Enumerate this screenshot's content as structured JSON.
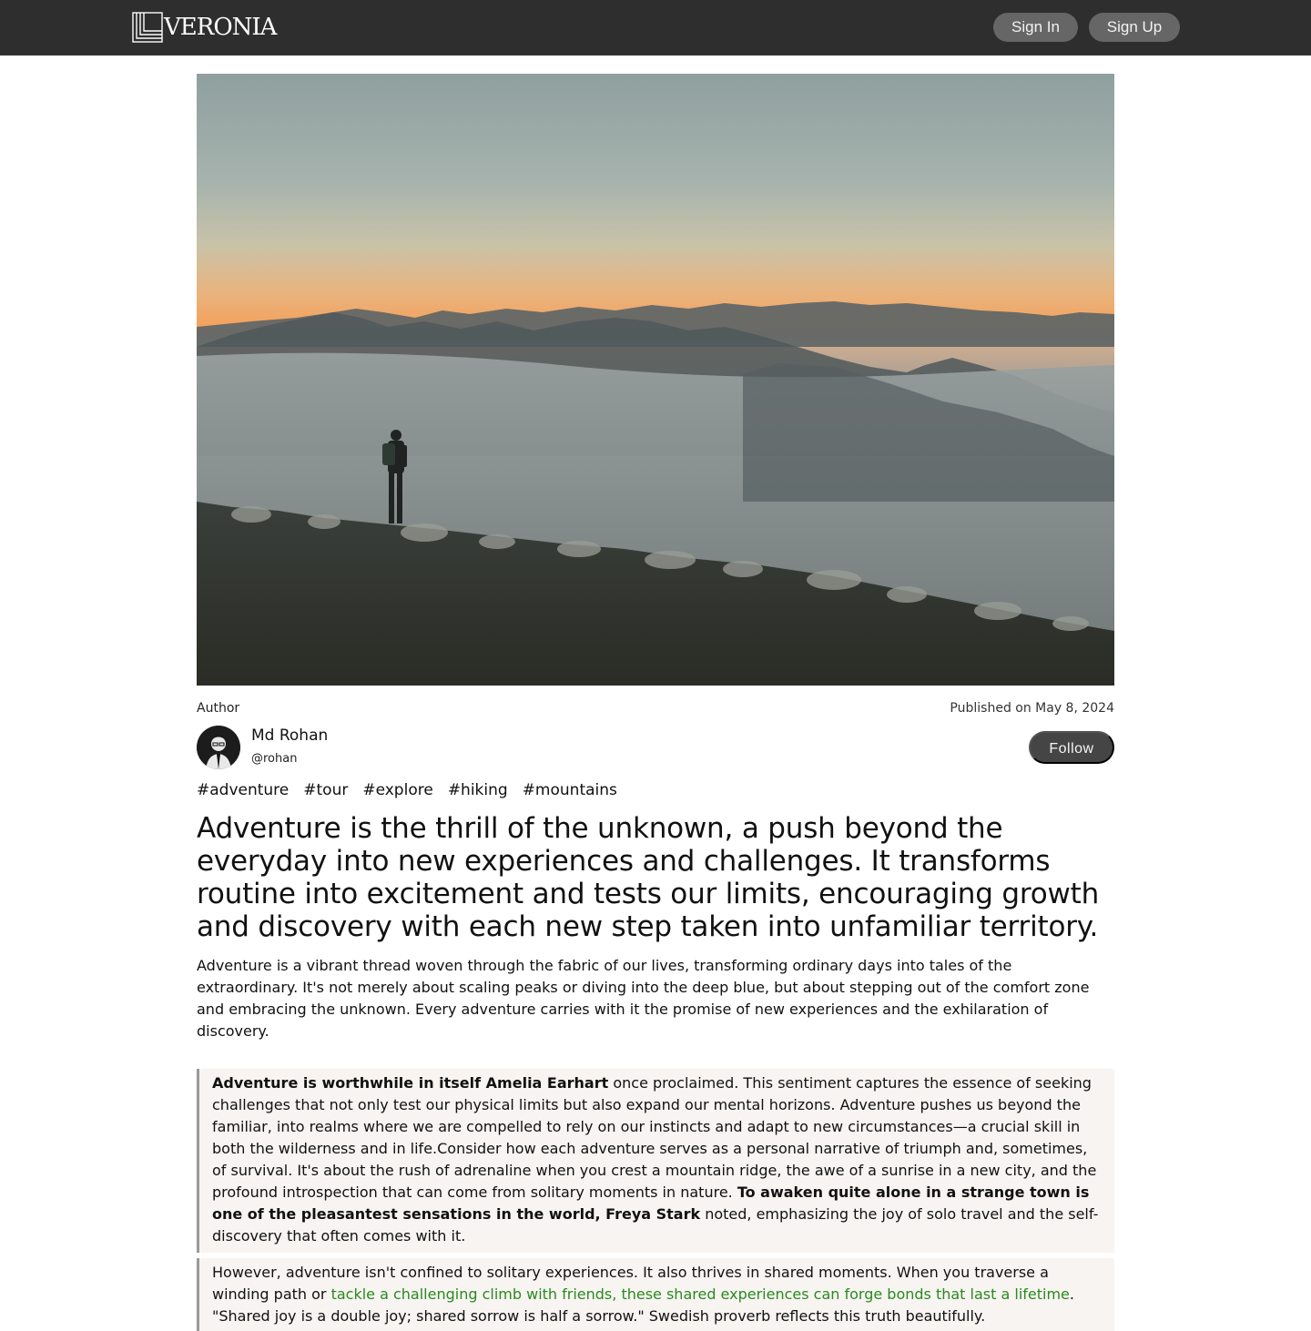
{
  "header": {
    "brand": "VERONIA",
    "sign_in": "Sign In",
    "sign_up": "Sign Up"
  },
  "hero": {
    "icon": "hiker-mountain-photo"
  },
  "author": {
    "label": "Author",
    "name": "Md Rohan",
    "handle": "@rohan",
    "published": "Published on May 8, 2024",
    "follow": "Follow"
  },
  "tags": [
    "#adventure",
    "#tour",
    "#explore",
    "#hiking",
    "#mountains"
  ],
  "article": {
    "headline": "Adventure is the thrill of the unknown, a push beyond the everyday into new experiences and challenges. It transforms routine into excitement and tests our limits, encouraging growth and discovery with each new step taken into unfamiliar territory.",
    "intro": "Adventure is a vibrant thread woven through the fabric of our lives, transforming ordinary days into tales of the extraordinary. It's not merely about scaling peaks or diving into the deep blue, but about stepping out of the comfort zone and embracing the unknown. Every adventure carries with it the promise of new experiences and the exhilaration of discovery.",
    "quote1": {
      "bold1": "Adventure is worthwhile in itself Amelia Earhart",
      "text1": " once proclaimed. This sentiment captures the essence of seeking challenges that not only test our physical limits but also expand our mental horizons. Adventure pushes us beyond the familiar, into realms where we are compelled to rely on our instincts and adapt to new circumstances—a crucial skill in both the wilderness and in life.Consider how each adventure serves as a personal narrative of triumph and, sometimes, of survival. It's about the rush of adrenaline when you crest a mountain ridge, the awe of a sunrise in a new city, and the profound introspection that can come from solitary moments in nature. ",
      "bold2": "To awaken quite alone in a strange town is one of the pleasantest sensations in the world, Freya Stark",
      "text2": " noted, emphasizing the joy of solo travel and the self-discovery that often comes with it."
    },
    "quote2": {
      "text1": "However, adventure isn't confined to solitary experiences. It also thrives in shared moments. When you traverse a winding path or ",
      "link": "tackle a challenging climb with friends, these shared experiences can forge bonds that last a lifetime",
      "text2": ". \"Shared joy is a double joy; shared sorrow is half a sorrow.\" Swedish proverb reflects this truth beautifully."
    }
  },
  "colors": {
    "header_bg": "#2e2e2e",
    "button_bg": "#666666",
    "follow_bg": "#454545",
    "quote_bg": "#f7f4f2",
    "link_green": "#2a8a1e"
  }
}
